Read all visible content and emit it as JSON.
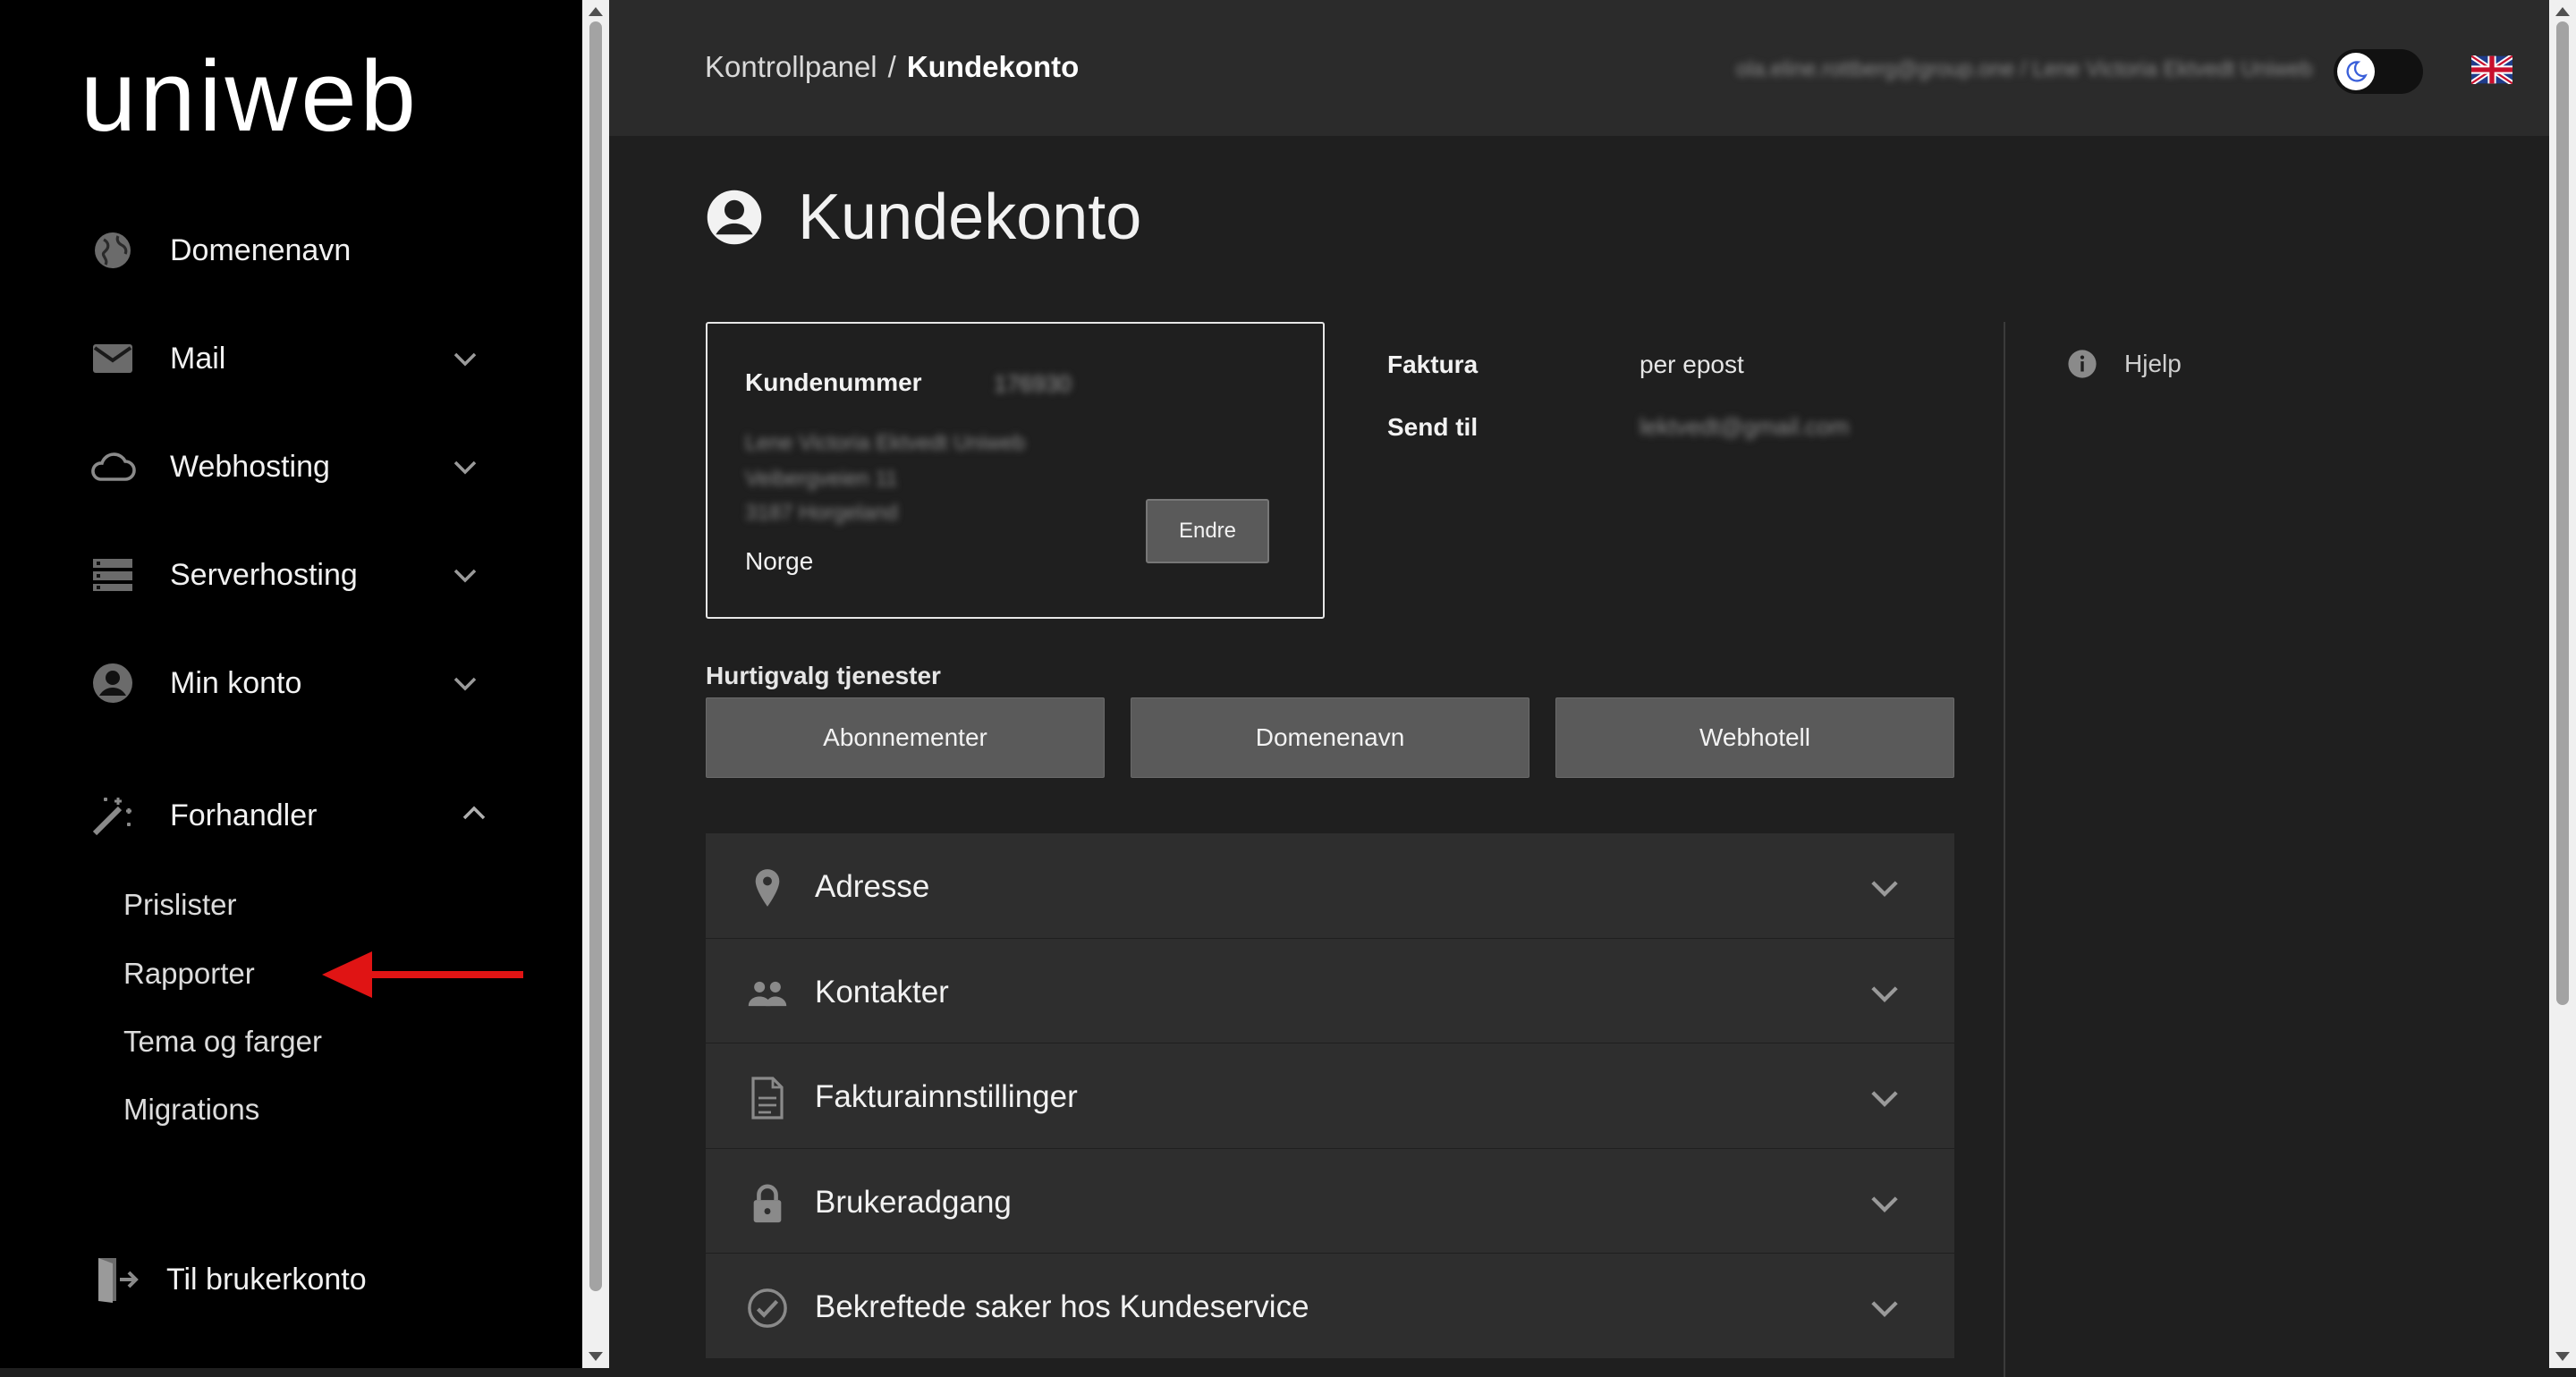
{
  "sidebar": {
    "logo_text": "uniweb",
    "items": [
      {
        "label": "Domenenavn",
        "icon": "globe-icon",
        "expandable": false
      },
      {
        "label": "Mail",
        "icon": "mail-icon",
        "expandable": true
      },
      {
        "label": "Webhosting",
        "icon": "cloud-icon",
        "expandable": true
      },
      {
        "label": "Serverhosting",
        "icon": "server-icon",
        "expandable": true
      },
      {
        "label": "Min konto",
        "icon": "account-circle-icon",
        "expandable": true
      },
      {
        "label": "Forhandler",
        "icon": "magic-wand-icon",
        "expandable": true,
        "expanded": true
      }
    ],
    "sub_items": [
      "Prislister",
      "Rapporter",
      "Tema og farger",
      "Migrations"
    ],
    "bottom_link": {
      "label": "Til brukerkonto",
      "icon": "exit-icon"
    }
  },
  "header": {
    "breadcrumb": {
      "parent": "Kontrollpanel",
      "separator": "/",
      "current": "Kundekonto"
    },
    "user_info": "ola.eline.rottberg@group.one / Lene Victoria Ektvedt Uniweb",
    "theme_icon": "moon-icon",
    "language_icon": "uk-flag-icon"
  },
  "main": {
    "title": "Kundekonto",
    "customer_card": {
      "number_label": "Kundenummer",
      "number_value": "176930",
      "name": "Lene Victoria Ektvedt Uniweb",
      "address_line1": "Veibergveien 11",
      "address_line2": "3187 Horgeland",
      "country": "Norge",
      "edit_button": "Endre"
    },
    "invoice": {
      "invoice_label": "Faktura",
      "invoice_value": "per epost",
      "send_to_label": "Send til",
      "send_to_value": "lektvedt@gmail.com"
    },
    "help_label": "Hjelp",
    "quick_title": "Hurtigvalg tjenester",
    "quick_buttons": [
      "Abonnementer",
      "Domenenavn",
      "Webhotell"
    ],
    "accordion": [
      {
        "label": "Adresse",
        "icon": "location-pin-icon"
      },
      {
        "label": "Kontakter",
        "icon": "people-icon"
      },
      {
        "label": "Fakturainnstillinger",
        "icon": "document-icon"
      },
      {
        "label": "Brukeradgang",
        "icon": "lock-icon"
      },
      {
        "label": "Bekreftede saker hos Kundeservice",
        "icon": "check-circle-icon"
      }
    ]
  },
  "colors": {
    "sidebar_bg": "#000000",
    "topbar_bg": "#2b2b2b",
    "main_bg": "#1f1f1f",
    "button_bg": "#5a5a5a",
    "accordion_bg": "#2e2e2e",
    "annotation_arrow": "#e01414"
  }
}
